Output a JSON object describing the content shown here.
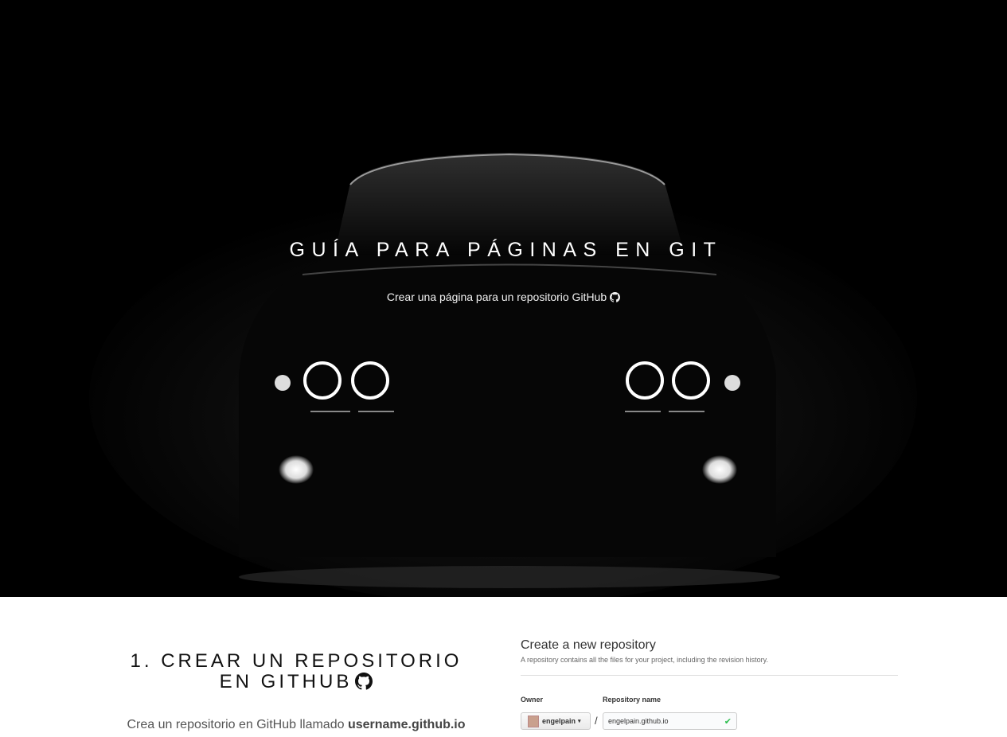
{
  "hero": {
    "title": "Guía para páginas en Git",
    "subtitle": "Crear una página para un repositorio GitHub"
  },
  "step1": {
    "title_line1": "1. Crear un repositorio",
    "title_line2": "en GitHub",
    "text_prefix": "Crea un repositorio en GitHub llamado ",
    "text_bold": "username.github.io"
  },
  "screenshot": {
    "heading": "Create a new repository",
    "description": "A repository contains all the files for your project, including the revision history.",
    "owner_label": "Owner",
    "repo_label": "Repository name",
    "owner_value": "engelpain",
    "slash": "/",
    "repo_value": "engelpain.github.io"
  },
  "icons": {
    "github": "github-icon",
    "check": "check-icon",
    "caret": "caret-down-icon"
  },
  "colors": {
    "hero_bg": "#000000",
    "hero_text": "#ffffff",
    "valid": "#2cbe4e"
  }
}
